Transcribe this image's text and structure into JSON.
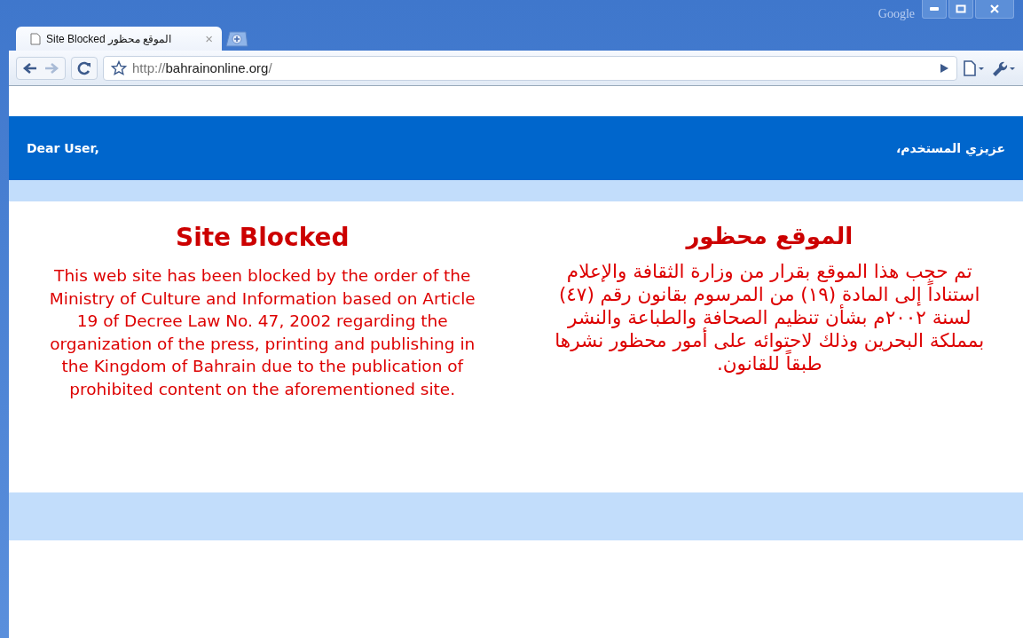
{
  "window": {
    "brand": "Google"
  },
  "tabs": [
    {
      "label": "Site Blocked الموقع محظور",
      "close": "×"
    }
  ],
  "toolbar": {
    "url_scheme": "http://",
    "url_host": "bahrainonline.org",
    "url_path": "/"
  },
  "header": {
    "greeting_en": "Dear User,",
    "greeting_ar": "عزيزي المستخدم،"
  },
  "notice_en": {
    "title": "Site Blocked",
    "body": "This web site has been blocked by the order of the Ministry of Culture and Information based on Article 19 of Decree Law No. 47, 2002 regarding the organization of the press, printing and publishing in the Kingdom of Bahrain due to the publication of prohibited content on the aforementioned site."
  },
  "notice_ar": {
    "title": "الموقع محظور",
    "body": "تم حجب هذا الموقع بقرار من وزارة الثقافة والإعلام استناداً إلى المادة (١٩) من المرسوم بقانون رقم (٤٧) لسنة ٢٠٠٢م بشأن تنظيم الصحافة والطباعة والنشر بمملكة البحرين وذلك لاحتوائه على أمور محظور نشرها طبقاً للقانون."
  }
}
